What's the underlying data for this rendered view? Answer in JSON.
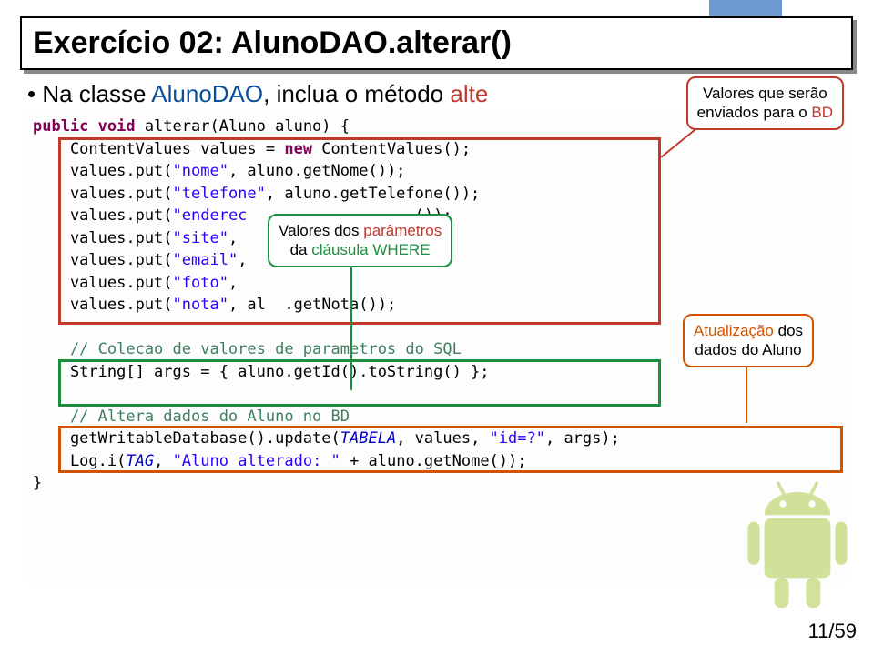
{
  "title": "Exercício 02: AlunoDAO.alterar()",
  "bullet": {
    "prefix": "Na classe ",
    "class_name": "AlunoDAO",
    "middle": ", inclua o método ",
    "method_name": "alte"
  },
  "code": {
    "l1": {
      "kw": "public void",
      "rest": " alterar(Aluno aluno) {"
    },
    "l2": {
      "p1": "    ContentValues values = ",
      "kw": "new",
      "p2": " ContentValues();"
    },
    "l3": {
      "p1": "    values.put(",
      "s": "\"nome\"",
      "p2": ", aluno.getNome());"
    },
    "l4": {
      "p1": "    values.put(",
      "s": "\"telefone\"",
      "p2": ", aluno.getTelefone());"
    },
    "l5": {
      "p1": "    values.put(",
      "s": "\"enderec",
      "p2": "                  ());"
    },
    "l6": {
      "p1": "    values.put(",
      "s": "\"site\"",
      "m": ",",
      "p2": "  "
    },
    "l7": {
      "p1": "    values.put(",
      "s": "\"email\"",
      "m": ",",
      "p2": "  "
    },
    "l8": {
      "p1": "    values.put(",
      "s": "\"foto\"",
      "m": ",",
      "p2": "                  "
    },
    "l9": {
      "p1": "    values.put(",
      "s": "\"nota\"",
      "m": ", al",
      "p2": "  .getNota());"
    },
    "l10": "",
    "l11": "    // Colecao de valores de parametros do SQL",
    "l12": "    String[] args = { aluno.getId().toString() };",
    "l13": "",
    "l14": "    // Altera dados do Aluno no BD",
    "l15": {
      "p1": "    getWritableDatabase().update(",
      "f": "TABELA",
      "p2": ", values, ",
      "s": "\"id=?\"",
      "p3": ", args);"
    },
    "l16": {
      "p1": "    Log.i(",
      "f": "TAG",
      "p2": ", ",
      "s": "\"Aluno alterado: \"",
      "p3": " + aluno.getNome());"
    },
    "l17": "}"
  },
  "callouts": {
    "c1": {
      "line1": "Valores que serão",
      "line2_a": "enviados para o ",
      "line2_b": "BD"
    },
    "c2": {
      "line1_a": "Valores dos ",
      "line1_b": "parâmetros",
      "line2_a": "da ",
      "line2_b": "cláusula WHERE"
    },
    "c3": {
      "line1_a": "Atualização",
      "line1_b": " dos",
      "line2": "dados do Aluno"
    }
  },
  "pager": "11/59"
}
